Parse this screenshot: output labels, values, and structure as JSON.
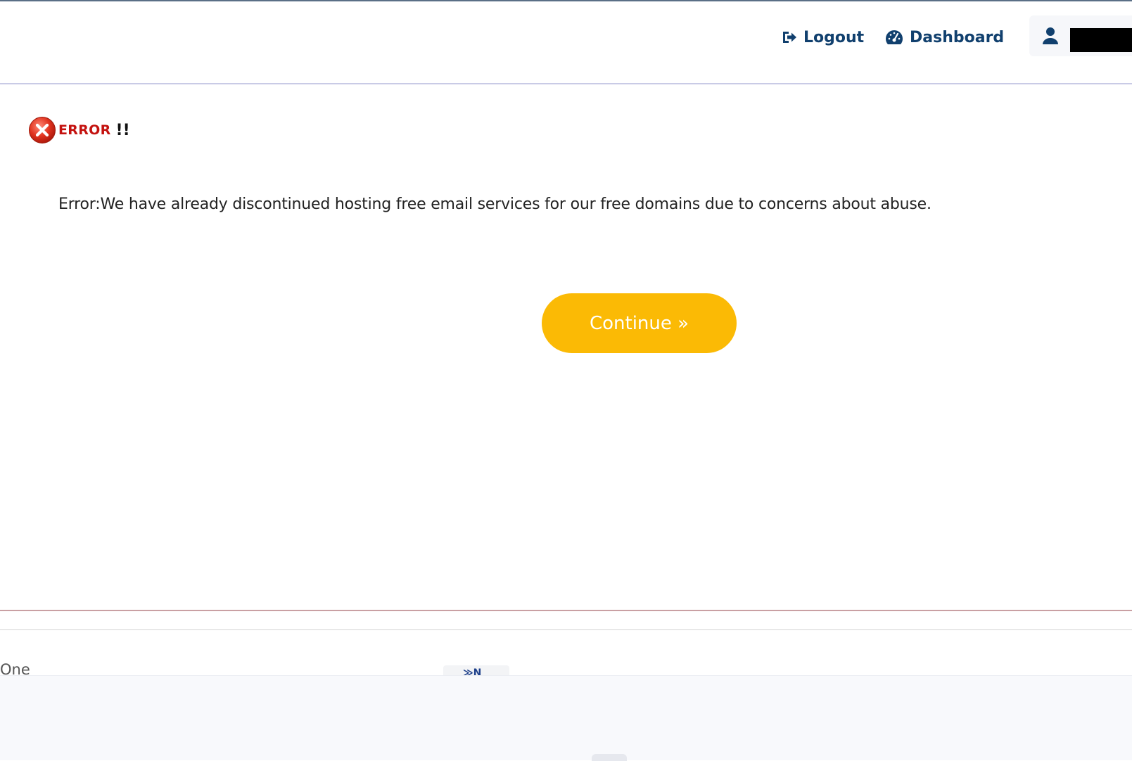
{
  "header": {
    "logout_label": "Logout",
    "dashboard_label": "Dashboard",
    "logout_icon": "logout-icon",
    "dashboard_icon": "dashboard-speedometer-icon",
    "user_icon": "user-icon",
    "link_color": "#11406e"
  },
  "error": {
    "heading": "ERROR",
    "emphasis": "!!",
    "message": "Error:We have already discontinued hosting free email services for our free domains due to concerns about abuse.",
    "icon": "error-x-circle-icon",
    "heading_color": "#c4120f"
  },
  "actions": {
    "continue_label": "Continue »",
    "accent_color": "#fbba05"
  },
  "footer": {
    "text": "One",
    "mark": "≫N"
  }
}
